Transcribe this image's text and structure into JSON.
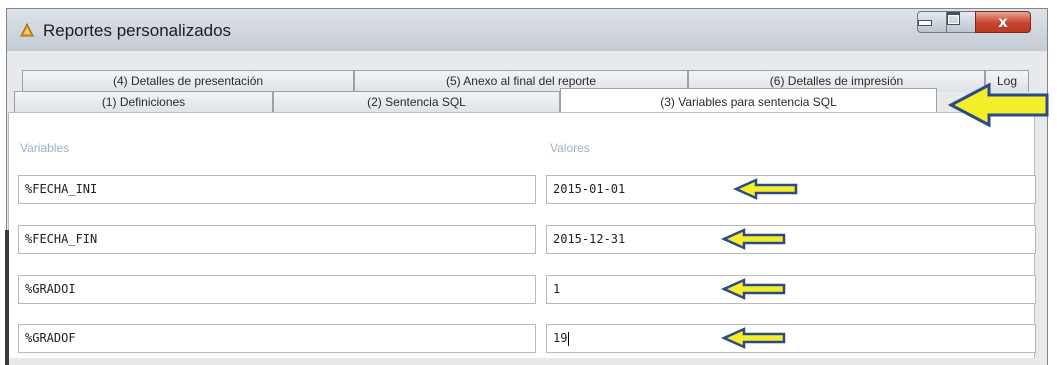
{
  "window": {
    "title": "Reportes personalizados",
    "controls": {
      "minimize": "minimize",
      "maximize": "maximize",
      "close": "x"
    }
  },
  "tabs": {
    "back_row": [
      {
        "label": "(4) Detalles de presentación"
      },
      {
        "label": "(5) Anexo al final del reporte"
      },
      {
        "label": "(6) Detalles de impresión"
      },
      {
        "label": "Log"
      }
    ],
    "front_row": [
      {
        "label": "(1) Definiciones"
      },
      {
        "label": "(2) Sentencia SQL"
      },
      {
        "label": "(3) Variables para sentencia SQL"
      }
    ],
    "active": "(3) Variables para sentencia SQL"
  },
  "form": {
    "variables_header": "Variables",
    "values_header": "Valores",
    "rows": [
      {
        "variable": "%FECHA_INI",
        "value": "2015-01-01"
      },
      {
        "variable": "%FECHA_FIN",
        "value": "2015-12-31"
      },
      {
        "variable": "%GRADOI",
        "value": "1"
      },
      {
        "variable": "%GRADOF",
        "value": "19"
      }
    ]
  },
  "annotations": {
    "arrow_fill": "#f4ee2a",
    "arrow_outline": "#2b4a86"
  },
  "icons": [
    "app-icon",
    "minimize-icon",
    "maximize-icon",
    "close-icon",
    "annotation-arrow-icon"
  ]
}
